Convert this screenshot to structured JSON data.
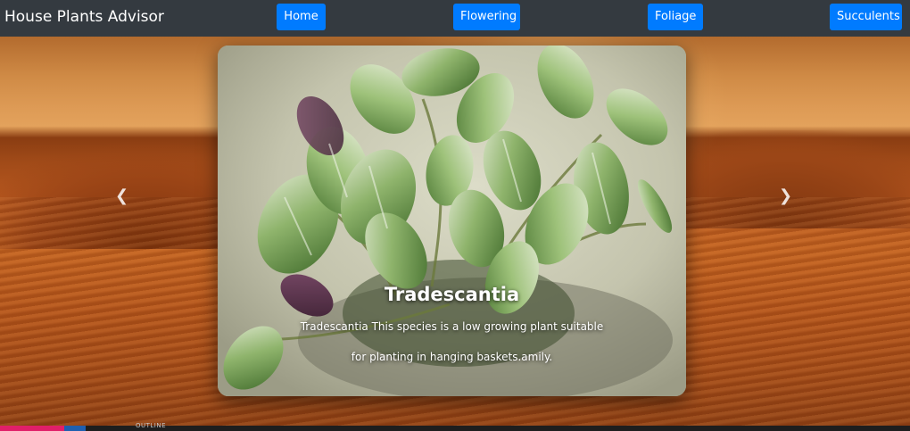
{
  "navbar": {
    "brand": "House Plants Advisor",
    "links": {
      "home": "Home",
      "flowering": "Flowering",
      "foliage": "Foliage",
      "succulents": "Succulents"
    }
  },
  "carousel": {
    "prev_icon": "chevron-left-icon",
    "next_icon": "chevron-right-icon",
    "slide": {
      "title": "Tradescantia",
      "description": "Tradescantia This species is a low growing plant suitable for planting in hanging baskets.amily."
    }
  },
  "taskbar": {
    "label": "OUTLINE"
  },
  "colors": {
    "navbar_bg": "#343a40",
    "button_primary": "#007bff",
    "text_light": "#ffffff"
  }
}
